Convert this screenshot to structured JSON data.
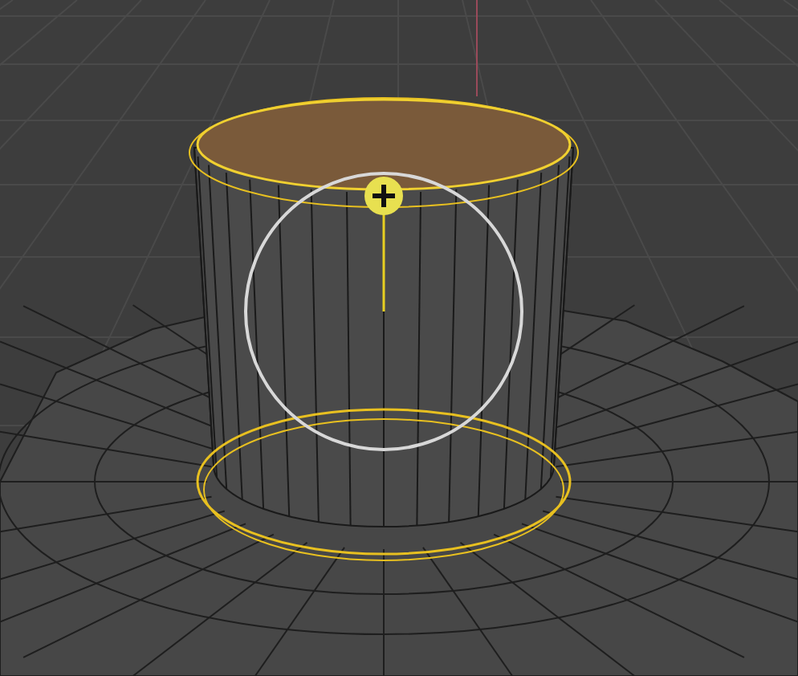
{
  "viewport": {
    "top_face": {
      "selected": true
    }
  }
}
